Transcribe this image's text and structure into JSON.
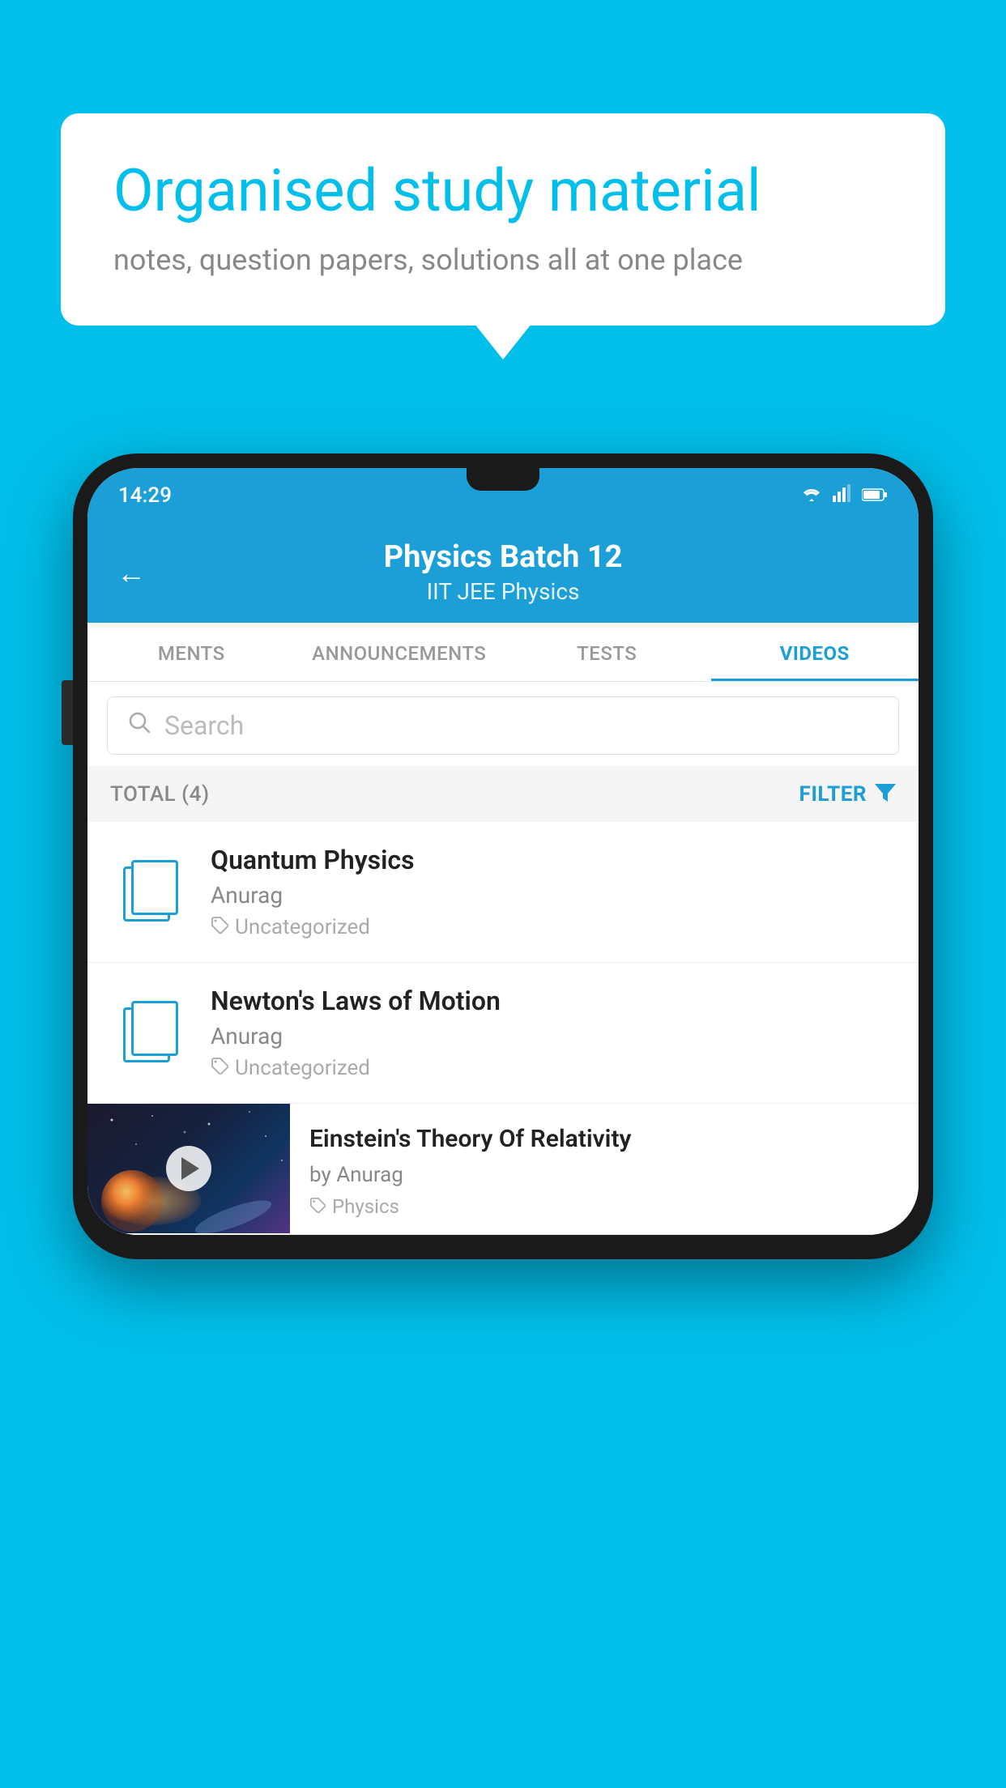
{
  "background_color": "#00BFEA",
  "bubble": {
    "title": "Organised study material",
    "subtitle": "notes, question papers, solutions all at one place"
  },
  "status_bar": {
    "time": "14:29",
    "wifi": "▼",
    "signal": "▲",
    "battery": "▐"
  },
  "header": {
    "back_label": "←",
    "title": "Physics Batch 12",
    "subtitle": "IIT JEE   Physics"
  },
  "tabs": [
    {
      "label": "MENTS",
      "active": false
    },
    {
      "label": "ANNOUNCEMENTS",
      "active": false
    },
    {
      "label": "TESTS",
      "active": false
    },
    {
      "label": "VIDEOS",
      "active": true
    }
  ],
  "search": {
    "placeholder": "Search"
  },
  "filter_row": {
    "total": "TOTAL (4)",
    "filter_label": "FILTER"
  },
  "videos": [
    {
      "title": "Quantum Physics",
      "author": "Anurag",
      "tag": "Uncategorized",
      "has_thumbnail": false
    },
    {
      "title": "Newton's Laws of Motion",
      "author": "Anurag",
      "tag": "Uncategorized",
      "has_thumbnail": false
    },
    {
      "title": "Einstein's Theory Of Relativity",
      "author": "by Anurag",
      "tag": "Physics",
      "has_thumbnail": true
    }
  ],
  "icons": {
    "back": "←",
    "search": "🔍",
    "filter": "▼",
    "tag": "🏷",
    "play": "▶"
  },
  "colors": {
    "primary": "#1b9fd6",
    "accent": "#00BFEA",
    "text_dark": "#222222",
    "text_muted": "#888888",
    "text_light": "#aaaaaa"
  }
}
